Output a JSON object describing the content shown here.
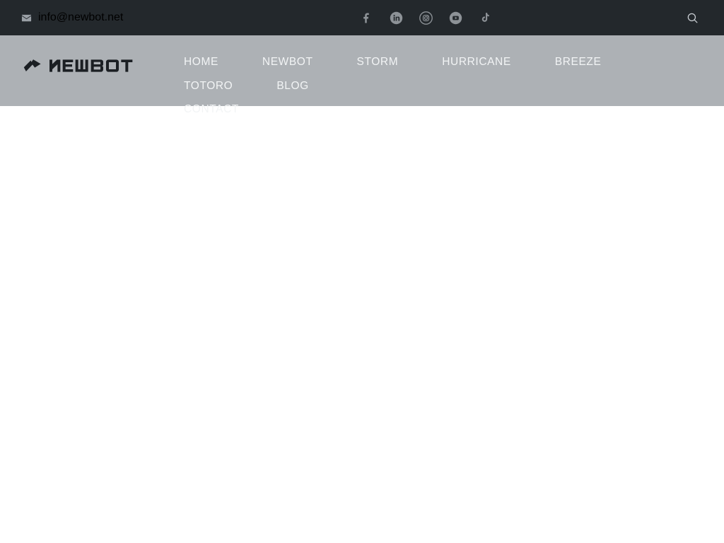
{
  "topbar": {
    "email_icon": "envelope-icon",
    "email": "info@newbot.net",
    "social": [
      {
        "name": "facebook",
        "icon": "facebook-icon",
        "label": "Facebook"
      },
      {
        "name": "linkedin",
        "icon": "linkedin-icon",
        "label": "LinkedIn"
      },
      {
        "name": "instagram",
        "icon": "instagram-icon",
        "label": "Instagram"
      },
      {
        "name": "youtube",
        "icon": "youtube-icon",
        "label": "YouTube"
      },
      {
        "name": "tiktok",
        "icon": "tiktok-icon",
        "label": "TikTok"
      }
    ],
    "search_icon": "search-icon",
    "search_label": "Search",
    "background_color": "#23282c",
    "text_color": "#b6bbc0"
  },
  "header": {
    "background_color": "#adb1b5",
    "logo": {
      "mark_icon": "newbot-pinwheel-logo-icon",
      "wordmark": "NEWBOT"
    },
    "nav": [
      {
        "label": "HOME",
        "key": "home"
      },
      {
        "label": "NEWBOT",
        "key": "newbot"
      },
      {
        "label": "STORM",
        "key": "storm"
      },
      {
        "label": "HURRICANE",
        "key": "hurricane"
      },
      {
        "label": "BREEZE",
        "key": "breeze"
      },
      {
        "label": "TOTORO",
        "key": "totoro"
      },
      {
        "label": "BLOG",
        "key": "blog"
      },
      {
        "label": "CONTACT",
        "key": "contact"
      }
    ],
    "nav_text_color": "#f2f4f5"
  },
  "body": {
    "background_color": "#ffffff",
    "content": ""
  }
}
